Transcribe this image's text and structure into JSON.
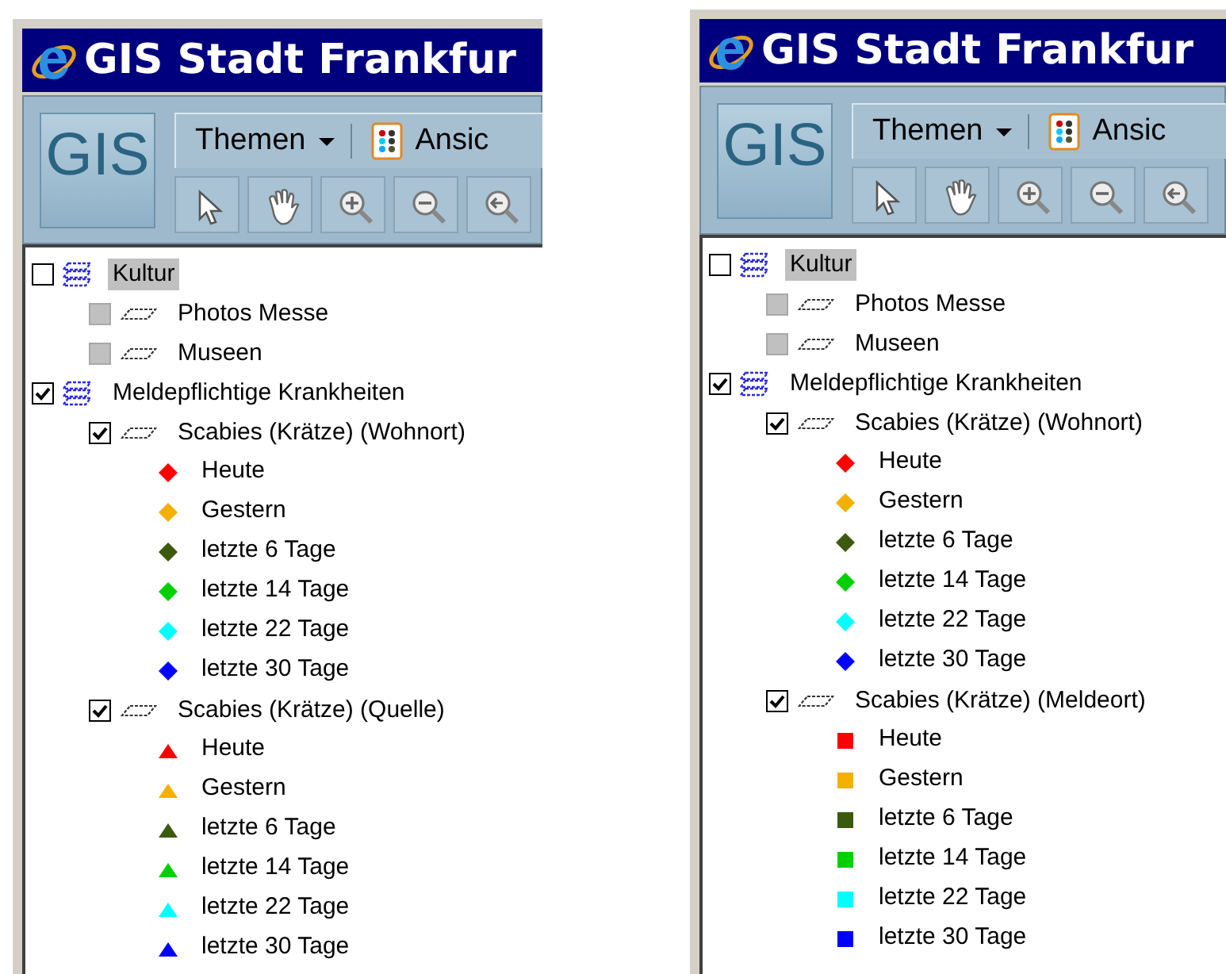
{
  "windows": [
    {
      "title": "GIS Stadt Frankfur",
      "logo": "GIS",
      "menus": [
        {
          "label": "Themen",
          "dropdown": true
        },
        {
          "label": "Ansic",
          "dropdown": false
        }
      ],
      "tools": [
        {
          "kind": "pointer"
        },
        {
          "kind": "hand"
        },
        {
          "kind": "zoomin"
        },
        {
          "kind": "zoomout"
        },
        {
          "kind": "zoomback"
        }
      ],
      "tree": [
        {
          "kind": "group",
          "label": "Kultur",
          "checked": false,
          "selected": true,
          "children": [
            {
              "kind": "layer",
              "label": "Photos Messe",
              "checked": false,
              "disabled": true
            },
            {
              "kind": "layer",
              "label": "Museen",
              "checked": false,
              "disabled": true
            }
          ]
        },
        {
          "kind": "group",
          "label": "Meldepflichtige Krankheiten",
          "checked": true,
          "selected": false,
          "children": [
            {
              "kind": "layer",
              "label": "Scabies (Krätze) (Wohnort)",
              "checked": true,
              "disabled": false,
              "children": [
                {
                  "kind": "diamond",
                  "color": "#ff0000",
                  "label": "Heute"
                },
                {
                  "kind": "diamond",
                  "color": "#f2b000",
                  "label": "Gestern"
                },
                {
                  "kind": "diamond",
                  "color": "#3c5a0e",
                  "label": "letzte 6 Tage"
                },
                {
                  "kind": "diamond",
                  "color": "#00d000",
                  "label": "letzte 14 Tage"
                },
                {
                  "kind": "diamond",
                  "color": "#00ffff",
                  "label": "letzte 22 Tage"
                },
                {
                  "kind": "diamond",
                  "color": "#0000ff",
                  "label": "letzte 30 Tage"
                }
              ]
            },
            {
              "kind": "layer",
              "label": "Scabies (Krätze) (Quelle)",
              "checked": true,
              "disabled": false,
              "children": [
                {
                  "kind": "triangle",
                  "color": "#ff0000",
                  "label": "Heute"
                },
                {
                  "kind": "triangle",
                  "color": "#f2b000",
                  "label": "Gestern"
                },
                {
                  "kind": "triangle",
                  "color": "#3c5a0e",
                  "label": "letzte 6 Tage"
                },
                {
                  "kind": "triangle",
                  "color": "#00d000",
                  "label": "letzte 14 Tage"
                },
                {
                  "kind": "triangle",
                  "color": "#00ffff",
                  "label": "letzte 22 Tage"
                },
                {
                  "kind": "triangle",
                  "color": "#0000ff",
                  "label": "letzte 30 Tage"
                }
              ]
            }
          ]
        }
      ]
    },
    {
      "title": "GIS Stadt Frankfur",
      "logo": "GIS",
      "menus": [
        {
          "label": "Themen",
          "dropdown": true
        },
        {
          "label": "Ansic",
          "dropdown": false
        }
      ],
      "tools": [
        {
          "kind": "pointer"
        },
        {
          "kind": "hand"
        },
        {
          "kind": "zoomin"
        },
        {
          "kind": "zoomout"
        },
        {
          "kind": "zoomback"
        }
      ],
      "tree": [
        {
          "kind": "group",
          "label": "Kultur",
          "checked": false,
          "selected": true,
          "children": [
            {
              "kind": "layer",
              "label": "Photos Messe",
              "checked": false,
              "disabled": true
            },
            {
              "kind": "layer",
              "label": "Museen",
              "checked": false,
              "disabled": true
            }
          ]
        },
        {
          "kind": "group",
          "label": "Meldepflichtige Krankheiten",
          "checked": true,
          "selected": false,
          "children": [
            {
              "kind": "layer",
              "label": "Scabies (Krätze) (Wohnort)",
              "checked": true,
              "disabled": false,
              "children": [
                {
                  "kind": "diamond",
                  "color": "#ff0000",
                  "label": "Heute"
                },
                {
                  "kind": "diamond",
                  "color": "#f2b000",
                  "label": "Gestern"
                },
                {
                  "kind": "diamond",
                  "color": "#3c5a0e",
                  "label": "letzte 6 Tage"
                },
                {
                  "kind": "diamond",
                  "color": "#00d000",
                  "label": "letzte 14 Tage"
                },
                {
                  "kind": "diamond",
                  "color": "#00ffff",
                  "label": "letzte 22 Tage"
                },
                {
                  "kind": "diamond",
                  "color": "#0000ff",
                  "label": "letzte 30 Tage"
                }
              ]
            },
            {
              "kind": "layer",
              "label": "Scabies (Krätze) (Meldeort)",
              "checked": true,
              "disabled": false,
              "children": [
                {
                  "kind": "square",
                  "color": "#ff0000",
                  "label": "Heute"
                },
                {
                  "kind": "square",
                  "color": "#f2b000",
                  "label": "Gestern"
                },
                {
                  "kind": "square",
                  "color": "#3c5a0e",
                  "label": "letzte 6 Tage"
                },
                {
                  "kind": "square",
                  "color": "#00d000",
                  "label": "letzte 14 Tage"
                },
                {
                  "kind": "square",
                  "color": "#00ffff",
                  "label": "letzte 22 Tage"
                },
                {
                  "kind": "square",
                  "color": "#0000ff",
                  "label": "letzte 30 Tage"
                }
              ]
            }
          ]
        }
      ]
    }
  ]
}
